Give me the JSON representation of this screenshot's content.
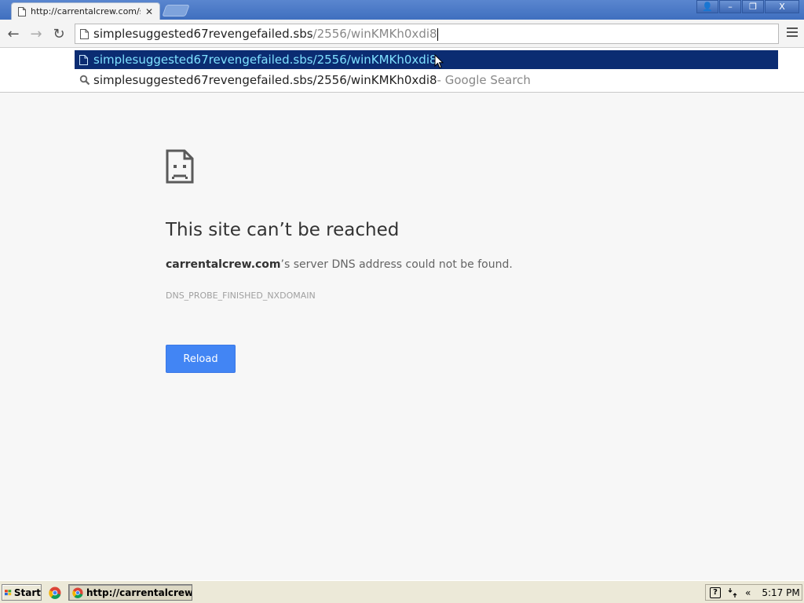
{
  "browser": {
    "tab": {
      "title": "http://carrentalcrew.com/sto",
      "close": "✕"
    },
    "window_buttons": {
      "user": "👤",
      "minimize": "–",
      "restore": "❐",
      "close": "X"
    },
    "nav": {
      "back": "←",
      "forward": "→",
      "reload": "↻"
    },
    "omnibox": {
      "host": "simplesuggested67revengefailed.sbs",
      "path": "/2556/winKMKh0xdi8"
    }
  },
  "autocomplete": {
    "items": [
      {
        "text": "simplesuggested67revengefailed.sbs/2556/winKMKh0xdi8",
        "icon": "page-icon",
        "selected": true
      },
      {
        "text": "simplesuggested67revengefailed.sbs/2556/winKMKh0xdi8",
        "suffix": " - Google Search",
        "icon": "search-icon",
        "selected": false
      }
    ]
  },
  "error_page": {
    "icon": "sad-page-icon",
    "title": "This site can’t be reached",
    "host": "carrentalcrew.com",
    "message": "’s server DNS address could not be found.",
    "code": "DNS_PROBE_FINISHED_NXDOMAIN",
    "reload_label": "Reload"
  },
  "taskbar": {
    "start_label": "Start",
    "window_label": "http://carrentalcrew....",
    "tray": {
      "help": "?",
      "chevron": "«",
      "clock": "5:17 PM"
    }
  },
  "colors": {
    "selection_bg": "#0b2c72",
    "selection_text": "#7fe0ff",
    "reload_button": "#4285f4",
    "title_bar": "#4a78c6"
  }
}
